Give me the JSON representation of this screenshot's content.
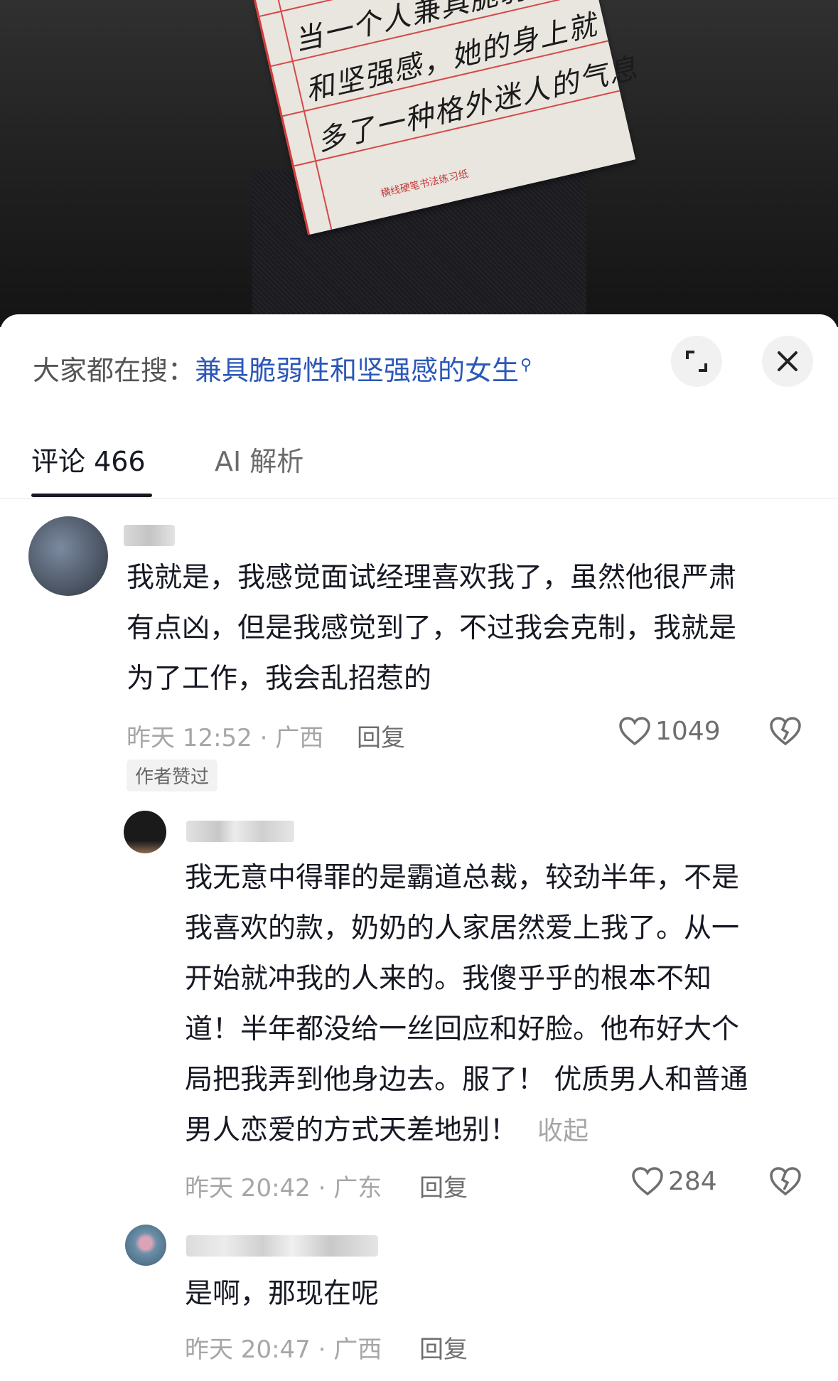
{
  "photo": {
    "handwriting": [
      "当一个人兼具脆弱性",
      "和坚强感，她的身上就",
      "多了一种格外迷人的气息"
    ],
    "paper_caption": "横线硬笔书法练习纸"
  },
  "search": {
    "prefix": "大家都在搜：",
    "term": "兼具脆弱性和坚强感的女生",
    "icon": "search-icon"
  },
  "buttons": {
    "expand_icon": "expand-icon",
    "close_icon": "close-icon"
  },
  "tabs": [
    {
      "label": "评论 466",
      "active": true
    },
    {
      "label": "AI 解析",
      "active": false
    }
  ],
  "comments": [
    {
      "text_lines": [
        "我就是，我感觉面试经理喜欢我了，虽然他很严肃",
        "有点凶，但是我感觉到了，不过我会克制，我就是",
        "为了工作，我会乱招惹的"
      ],
      "time_location": "昨天 12:52 · 广西",
      "reply_label": "回复",
      "likes": "1049",
      "badge": "作者赞过"
    },
    {
      "text_lines": [
        "我无意中得罪的是霸道总裁，较劲半年，不是",
        "我喜欢的款，奶奶的人家居然爱上我了。从一",
        "开始就冲我的人来的。我傻乎乎的根本不知",
        "道！半年都没给一丝回应和好脸。他布好大个",
        "局把我弄到他身边去。服了！ 优质男人和普通",
        "男人恋爱的方式天差地别！"
      ],
      "collapse_label": "收起",
      "time_location": "昨天 20:42 · 广东",
      "reply_label": "回复",
      "likes": "284"
    },
    {
      "text_lines": [
        "是啊，那现在呢"
      ],
      "time_location": "昨天 20:47 · 广西",
      "reply_label": "回复"
    }
  ]
}
